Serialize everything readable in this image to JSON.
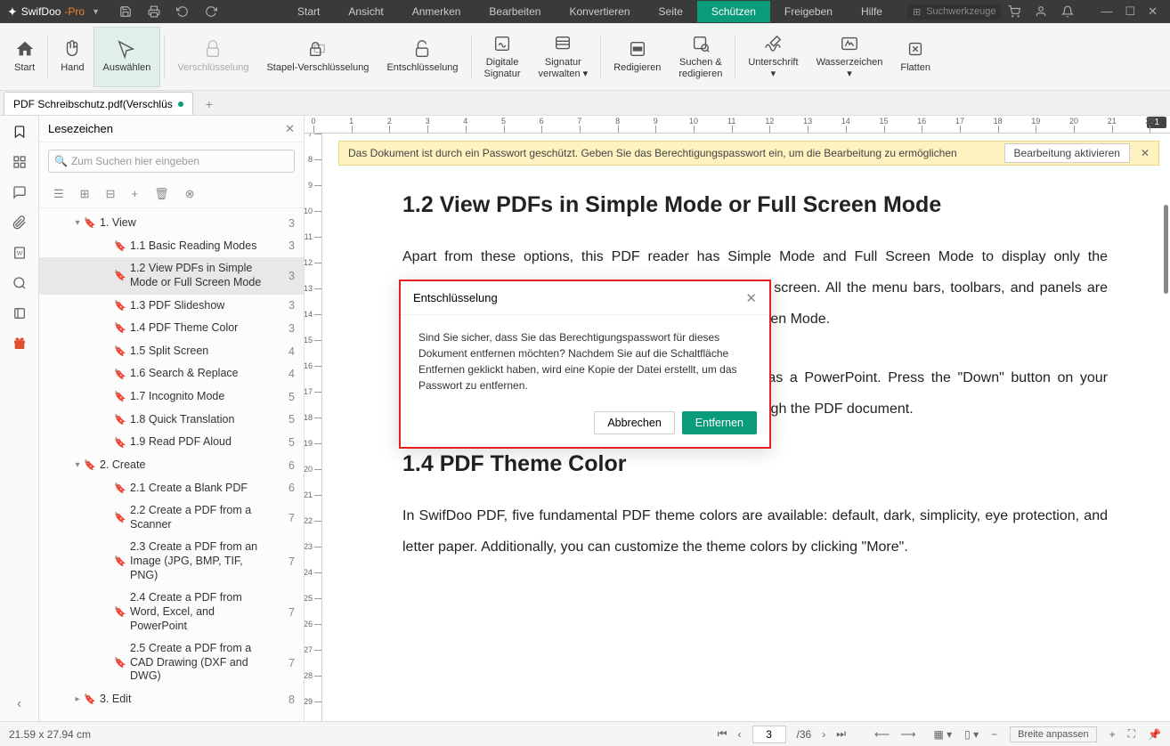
{
  "titlebar": {
    "brand": "SwifDoo",
    "brand_suffix": "-Pro",
    "menu": [
      "Start",
      "Ansicht",
      "Anmerken",
      "Bearbeiten",
      "Konvertieren",
      "Seite",
      "Schützen",
      "Freigeben",
      "Hilfe"
    ],
    "menu_active_index": 6,
    "search_placeholder": "Suchwerkzeuge"
  },
  "ribbon": {
    "tools": [
      {
        "label": "Start",
        "icon": "home"
      },
      {
        "label": "Hand",
        "icon": "hand"
      },
      {
        "label": "Auswählen",
        "icon": "cursor",
        "selected": true
      },
      {
        "label": "Verschlüsselung",
        "icon": "lock",
        "disabled": true
      },
      {
        "label": "Stapel-Verschlüsselung",
        "icon": "lock-stack"
      },
      {
        "label": "Entschlüsselung",
        "icon": "unlock"
      },
      {
        "label": "Digitale\nSignatur",
        "icon": "sig"
      },
      {
        "label": "Signatur\nverwalten ▾",
        "icon": "sig-manage"
      },
      {
        "label": "Redigieren",
        "icon": "redact"
      },
      {
        "label": "Suchen &\nredigieren",
        "icon": "search-redact"
      },
      {
        "label": "Unterschrift\n▾",
        "icon": "sign"
      },
      {
        "label": "Wasserzeichen\n▾",
        "icon": "watermark"
      },
      {
        "label": "Flatten",
        "icon": "flatten"
      }
    ]
  },
  "tab": {
    "name": "PDF Schreibschutz.pdf(Verschlüs"
  },
  "panel": {
    "title": "Lesezeichen",
    "search_placeholder": "Zum Suchen hier eingeben",
    "tree": [
      {
        "label": "1. View",
        "page": "3",
        "level": 0,
        "exp": true
      },
      {
        "label": "1.1 Basic Reading Modes",
        "page": "3",
        "level": 1
      },
      {
        "label": "1.2 View PDFs in Simple Mode or Full Screen Mode",
        "page": "3",
        "level": 1,
        "selected": true
      },
      {
        "label": "1.3 PDF Slideshow",
        "page": "3",
        "level": 1
      },
      {
        "label": "1.4 PDF Theme Color",
        "page": "3",
        "level": 1
      },
      {
        "label": "1.5 Split Screen",
        "page": "4",
        "level": 1
      },
      {
        "label": "1.6 Search & Replace",
        "page": "4",
        "level": 1
      },
      {
        "label": "1.7 Incognito Mode",
        "page": "5",
        "level": 1
      },
      {
        "label": "1.8 Quick Translation",
        "page": "5",
        "level": 1
      },
      {
        "label": "1.9 Read PDF Aloud",
        "page": "5",
        "level": 1
      },
      {
        "label": "2. Create",
        "page": "6",
        "level": 0,
        "exp": true
      },
      {
        "label": "2.1 Create a Blank PDF",
        "page": "6",
        "level": 1
      },
      {
        "label": "2.2 Create a PDF from a Scanner",
        "page": "7",
        "level": 1
      },
      {
        "label": "2.3 Create a PDF from an Image (JPG, BMP, TIF, PNG)",
        "page": "7",
        "level": 1
      },
      {
        "label": "2.4 Create a PDF from Word, Excel, and PowerPoint",
        "page": "7",
        "level": 1
      },
      {
        "label": "2.5 Create a PDF from a CAD Drawing (DXF and DWG)",
        "page": "7",
        "level": 1
      },
      {
        "label": "3. Edit",
        "page": "8",
        "level": 0,
        "exp": false
      }
    ]
  },
  "banner": {
    "text": "Das Dokument ist durch ein Passwort geschützt. Geben Sie das Berechtigungspasswort ein, um die Bearbeitung zu ermöglichen",
    "button": "Bearbeitung aktivieren"
  },
  "doc": {
    "h1": "1.2 View PDFs in Simple Mode or Full Screen Mode",
    "p1": "Apart from these options, this PDF reader has Simple Mode and Full Screen Mode to display only the document, either in a minimized window or on the entire screen. All the menu bars, toolbars, and panels are hidden. You can press \"Esc\" to exit the Simple or Full Screen Mode.",
    "h2pre": "",
    "p2": "Choose the PDF Slideshow tool. It will display a PDF as a PowerPoint. Press the \"Down\" button on your keyboard or scroll down with your mouse to navigate through the PDF document.",
    "h3": "1.4 PDF Theme Color",
    "p3": "In SwifDoo PDF, five fundamental PDF theme colors are available: default, dark, simplicity, eye protection, and letter paper. Additionally, you can customize the theme colors by clicking \"More\"."
  },
  "dialog": {
    "title": "Entschlüsselung",
    "body": "Sind Sie sicher, dass Sie das Berechtigungspasswort für dieses Dokument entfernen möchten? Nachdem Sie auf die Schaltfläche Entfernen geklickt haben, wird eine Kopie der Datei erstellt, um das Passwort zu entfernen.",
    "cancel": "Abbrechen",
    "ok": "Entfernen"
  },
  "ruler": {
    "page_indicator": "1"
  },
  "status": {
    "dims": "21.59 x 27.94 cm",
    "page_current": "3",
    "page_total": "/36",
    "zoom_label": "Breite anpassen"
  }
}
